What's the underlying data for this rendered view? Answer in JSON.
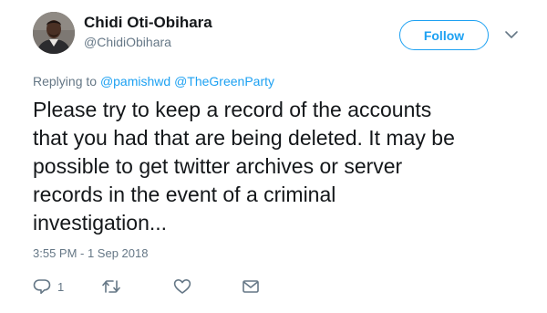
{
  "author": {
    "display_name": "Chidi Oti-Obihara",
    "handle": "@ChidiObihara"
  },
  "follow_label": "Follow",
  "replying": {
    "prefix": "Replying to",
    "mentions": [
      "@pamishwd",
      "@TheGreenParty"
    ]
  },
  "tweet_lines": [
    "Please try to keep a record of the accounts",
    "that you had that are being deleted. It may be",
    "possible to get twitter archives or server",
    "records in the event of a criminal",
    "investigation..."
  ],
  "timestamp": "3:55 PM - 1 Sep 2018",
  "actions": {
    "reply_count": "1"
  },
  "colors": {
    "accent": "#1da1f2",
    "text": "#14171a",
    "secondary": "#657786",
    "icon": "#657786"
  },
  "icons": {
    "avatar": "profile-photo",
    "caret": "chevron-down-icon",
    "reply": "speech-bubble-icon",
    "retweet": "retweet-arrows-icon",
    "like": "heart-outline-icon",
    "message": "envelope-icon"
  }
}
